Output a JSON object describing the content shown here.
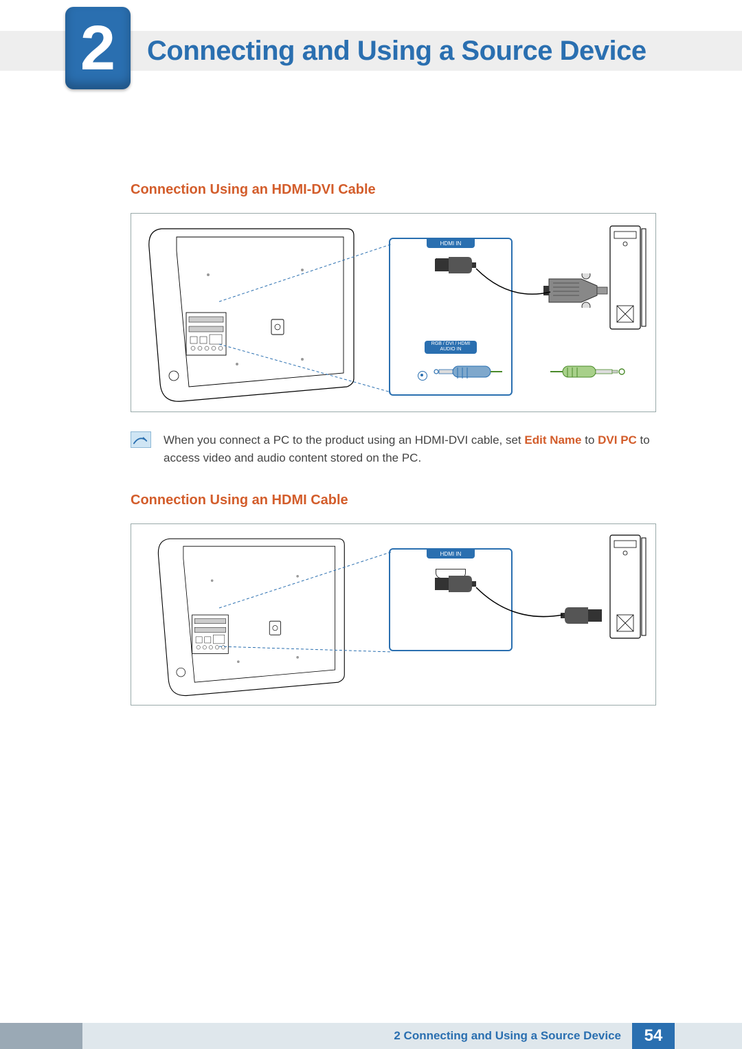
{
  "chapter": {
    "number": "2",
    "title": "Connecting and Using a Source Device"
  },
  "sections": {
    "hdmi_dvi": {
      "heading": "Connection Using an HDMI-DVI Cable",
      "labels": {
        "hdmi_in": "HDMI IN",
        "rgb_dvi_audio": "RGB / DVI / HDMI AUDIO IN"
      }
    },
    "hdmi": {
      "heading": "Connection Using an HDMI Cable",
      "labels": {
        "hdmi_in": "HDMI IN"
      }
    }
  },
  "note": {
    "prefix": "When you connect a PC to the product using an HDMI-DVI cable, set ",
    "em1": "Edit Name",
    "mid": " to ",
    "em2": "DVI PC",
    "suffix": " to access video and audio content stored on the PC."
  },
  "footer": {
    "text": "2 Connecting and Using a Source Device",
    "page": "54"
  }
}
